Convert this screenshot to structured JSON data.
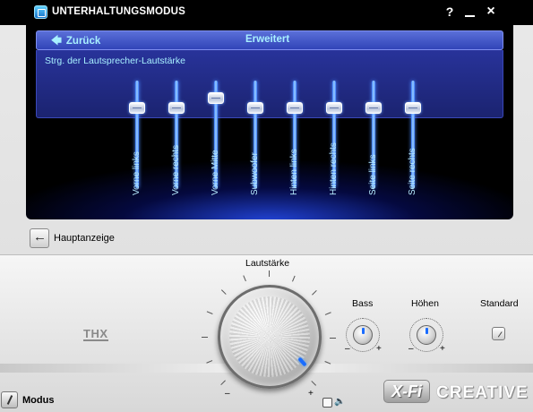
{
  "window": {
    "title": "UNTERHALTUNGSMODUS",
    "help_label": "?"
  },
  "panel": {
    "back_label": "Zurück",
    "tab_label": "Erweitert",
    "caption": "Strg. der Lautsprecher-Lautstärke"
  },
  "channels": [
    {
      "label": "Vorne links",
      "level": 0.75
    },
    {
      "label": "Vorne rechts",
      "level": 0.75
    },
    {
      "label": "Vorne Mitte",
      "level": 0.84
    },
    {
      "label": "Subwoofer",
      "level": 0.75
    },
    {
      "label": "Hinten links",
      "level": 0.75
    },
    {
      "label": "Hinten rechts",
      "level": 0.75
    },
    {
      "label": "Seite links",
      "level": 0.75
    },
    {
      "label": "Seite rechts",
      "level": 0.75
    }
  ],
  "nav": {
    "main_view_label": "Hauptanzeige"
  },
  "console": {
    "thx_logo": "THX",
    "volume_label": "Lautstärke",
    "volume_minus": "–",
    "volume_plus": "+",
    "bass_label": "Bass",
    "treble_label": "Höhen",
    "knob_minus": "–",
    "knob_plus": "+",
    "standard_label": "Standard",
    "mode_label": "Modus",
    "brand_xfi": "X-Fi",
    "brand_creative": "CREATIVE"
  },
  "colors": {
    "accent": "#1a6cff",
    "panel_text": "#a8f0ff",
    "panel_header": "#3d52c8"
  }
}
